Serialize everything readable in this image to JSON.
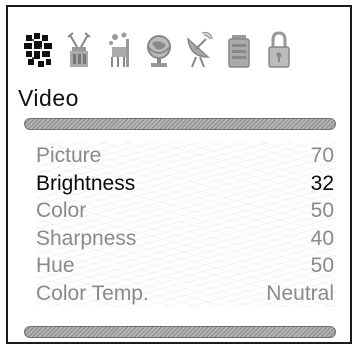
{
  "icons": [
    "picture-settings-icon",
    "tools-icon",
    "setup-icon",
    "globe-icon",
    "satellite-dish-icon",
    "battery-icon",
    "lock-icon"
  ],
  "menu": {
    "title": "Video",
    "selected": "Brightness"
  },
  "settings": [
    {
      "label": "Picture",
      "value": "70"
    },
    {
      "label": "Brightness",
      "value": "32"
    },
    {
      "label": "Color",
      "value": "50"
    },
    {
      "label": "Sharpness",
      "value": "40"
    },
    {
      "label": "Hue",
      "value": "50"
    },
    {
      "label": "Color Temp.",
      "value": "Neutral"
    }
  ],
  "colors": {
    "selected_text": "#0a0a0a",
    "unselected_text": "#8a8a8a",
    "separator": "#9e9e9e"
  }
}
